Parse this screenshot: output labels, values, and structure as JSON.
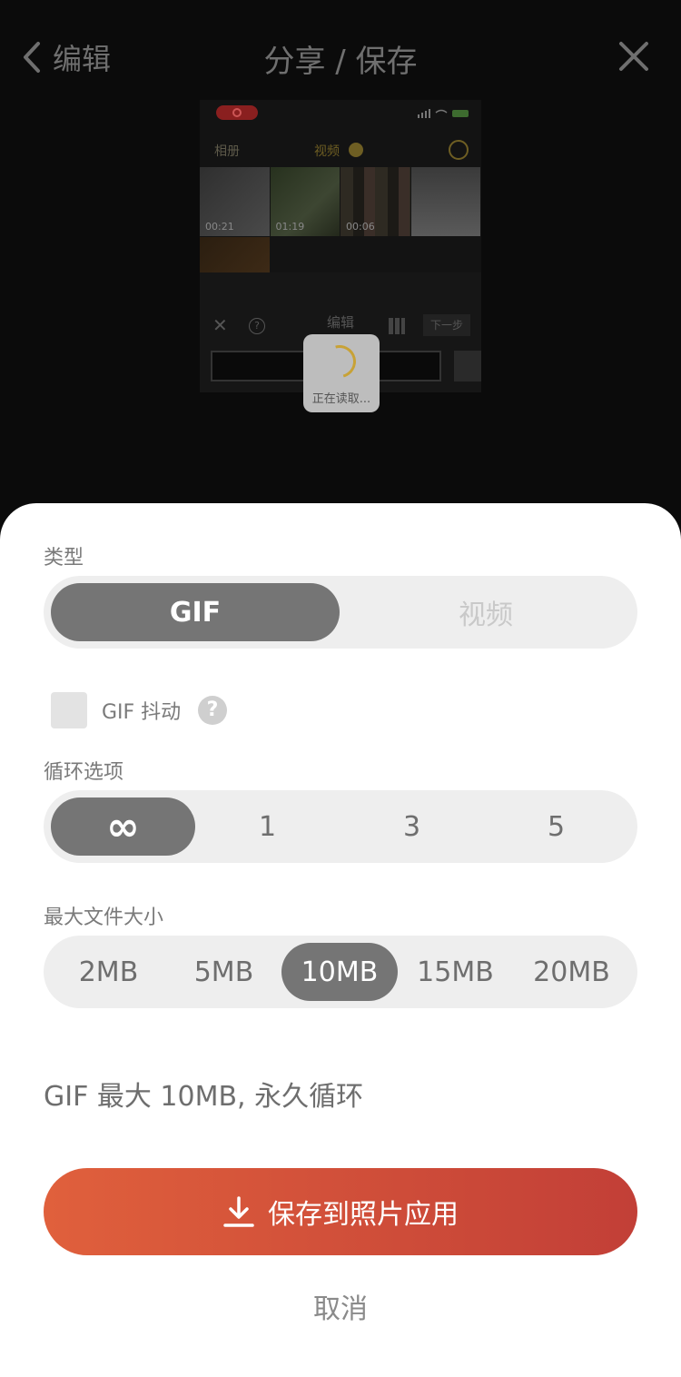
{
  "header": {
    "back_label": "编辑",
    "title": "分享 / 保存"
  },
  "preview": {
    "nav_back": "相册",
    "nav_title": "视频",
    "thumb_durations": [
      "00:21",
      "01:19",
      "00:06",
      ""
    ],
    "toolbar_title": "编辑",
    "next_label": "下一步",
    "loading_text": "正在读取..."
  },
  "type_section": {
    "label": "类型",
    "options": [
      "GIF",
      "视频"
    ],
    "selected": "GIF"
  },
  "jitter": {
    "label": "GIF 抖动",
    "checked": false,
    "help": "?"
  },
  "loop_section": {
    "label": "循环选项",
    "options": [
      "∞",
      "1",
      "3",
      "5"
    ],
    "selected": "∞"
  },
  "size_section": {
    "label": "最大文件大小",
    "options": [
      "2MB",
      "5MB",
      "10MB",
      "15MB",
      "20MB"
    ],
    "selected": "10MB"
  },
  "summary": "GIF 最大 10MB, 永久循环",
  "save_button": "保存到照片应用",
  "cancel_button": "取消",
  "colors": {
    "accent_start": "#e0603c",
    "accent_end": "#c23f37",
    "selected_segment": "#757575"
  }
}
